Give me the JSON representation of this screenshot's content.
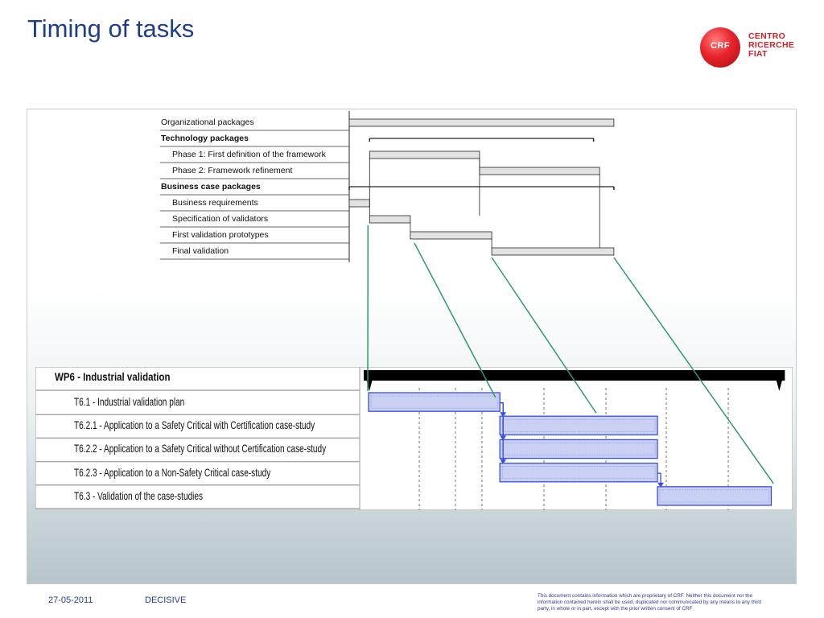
{
  "title": "Timing of tasks",
  "logo": {
    "abbr": "CRF",
    "lines": [
      "CENTRO",
      "RICERCHE",
      "FIAT"
    ],
    "color": "#d42027"
  },
  "top_chart": {
    "rows": [
      {
        "label": "Organizational packages",
        "level": 0,
        "bold": false,
        "kind": "bar",
        "start": 0,
        "end": 13
      },
      {
        "label": "Technology packages",
        "level": 0,
        "bold": true,
        "kind": "summary",
        "start": 1,
        "end": 12
      },
      {
        "label": "Phase 1: First definition of the framework",
        "level": 1,
        "bold": false,
        "kind": "bar",
        "start": 1,
        "end": 6.4
      },
      {
        "label": "Phase 2: Framework refinement",
        "level": 1,
        "bold": false,
        "kind": "bar",
        "start": 6.4,
        "end": 12.3
      },
      {
        "label": "Business case packages",
        "level": 0,
        "bold": true,
        "kind": "summary",
        "start": 0,
        "end": 13
      },
      {
        "label": "Business requirements",
        "level": 1,
        "bold": false,
        "kind": "bar",
        "start": 0,
        "end": 1
      },
      {
        "label": "Specification of validators",
        "level": 1,
        "bold": false,
        "kind": "bar",
        "start": 1,
        "end": 3
      },
      {
        "label": "First validation prototypes",
        "level": 1,
        "bold": false,
        "kind": "bar",
        "start": 3,
        "end": 7
      },
      {
        "label": "Final validation",
        "level": 1,
        "bold": false,
        "kind": "bar",
        "start": 7,
        "end": 13
      }
    ]
  },
  "wp6_chart": {
    "header": "WP6 - Industrial validation",
    "tasks": [
      {
        "label": "T6.1 - Industrial validation plan",
        "start": 0,
        "end": 6
      },
      {
        "label": "T6.2.1 - Application to a Safety Critical with Certification case-study",
        "start": 6,
        "end": 13.2
      },
      {
        "label": "T6.2.2 - Application to a Safety Critical without Certification case-study",
        "start": 6,
        "end": 13.2
      },
      {
        "label": "T6.2.3 - Application to a Non-Safety Critical case-study",
        "start": 6,
        "end": 13.2
      },
      {
        "label": "T6.3 - Validation of the case-studies",
        "start": 13.2,
        "end": 18.4
      }
    ]
  },
  "colors": {
    "title": "#1f3e8a",
    "task_bar": "#3a4ee0",
    "task_fill": "#c9d0f3",
    "connector": "#2e9a6a",
    "summary_bar": "#000000"
  },
  "footer": {
    "date": "27-05-2011",
    "project": "DECISIVE",
    "disclaimer": "This document contains information which are proprietary of CRF. Neither this document nor the information contained herein shall be used, duplicated nor communicated by any means to any third party, in whole or in part, except with the prior written consent of CRF"
  }
}
